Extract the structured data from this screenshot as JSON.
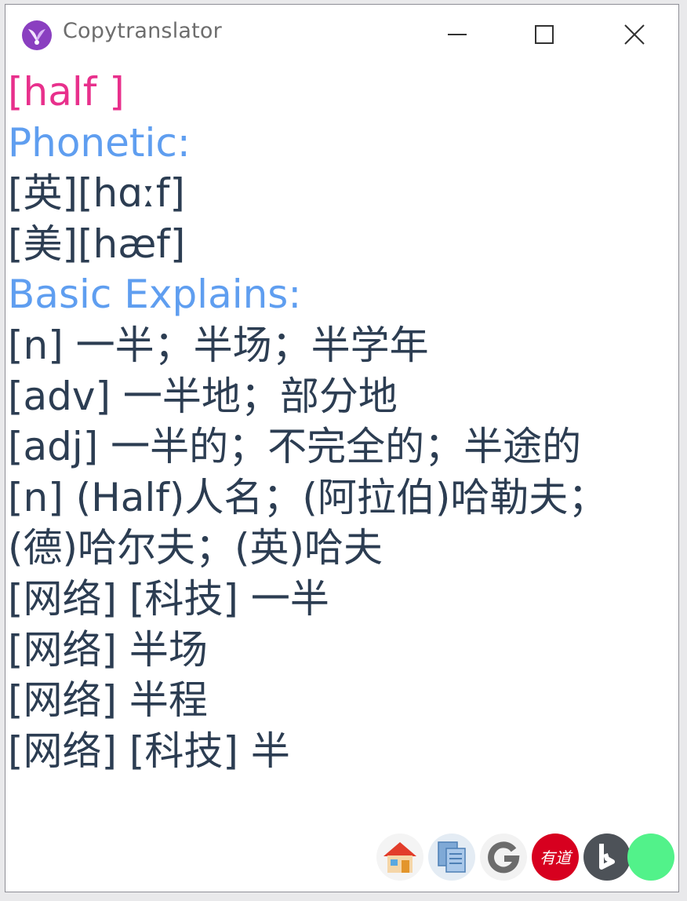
{
  "window": {
    "title": "Copytranslator"
  },
  "result": {
    "word_line": "[half ]",
    "phonetic_heading": "Phonetic:",
    "phonetic_uk": "[英][hɑːf]",
    "phonetic_us": "[美][hæf]",
    "explains_heading": "Basic Explains:",
    "lines": [
      "[n] 一半；半场；半学年",
      "[adv] 一半地；部分地",
      "[adj] 一半的；不完全的；半途的",
      "[n] (Half)人名；(阿拉伯)哈勒夫；",
      "(德)哈尔夫；(英)哈夫",
      "[网络] [科技] 一半",
      "[网络] 半场",
      "[网络] 半程",
      "[网络] [科技] 半"
    ]
  },
  "dock": {
    "items": [
      {
        "name": "home-icon"
      },
      {
        "name": "copy-docs-icon"
      },
      {
        "name": "google-icon"
      },
      {
        "name": "youdao-icon",
        "label": "有道"
      },
      {
        "name": "bing-icon"
      },
      {
        "name": "green-status-icon"
      }
    ]
  },
  "colors": {
    "word": "#e8308c",
    "heading": "#5f9ef0",
    "text": "#2c3d52",
    "youdao_red": "#d7001f",
    "status_green": "#52f28a"
  }
}
